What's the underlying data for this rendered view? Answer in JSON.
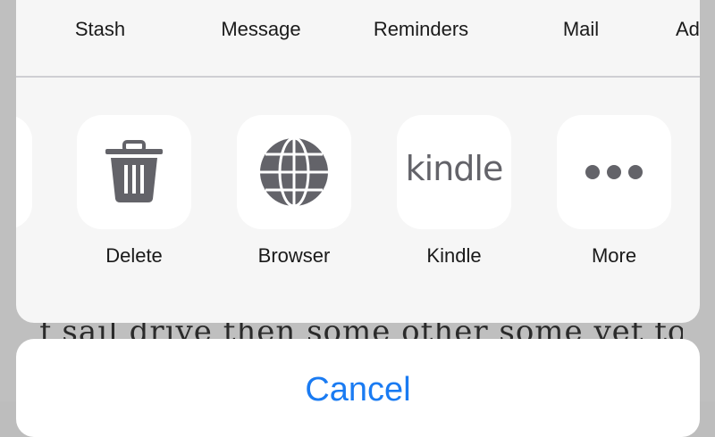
{
  "background_text": "f  sail  drive  then  some  other  some  yet  to  know",
  "share_row": {
    "apps": [
      {
        "label": "Stash",
        "icon": "stash-app-icon"
      },
      {
        "label": "Message",
        "icon": "message-app-icon"
      },
      {
        "label": "Reminders",
        "icon": "reminders-app-icon"
      },
      {
        "label": "Mail",
        "icon": "mail-app-icon"
      },
      {
        "label": "Ad",
        "icon": "add-app-icon"
      }
    ]
  },
  "action_row": {
    "actions": [
      {
        "label": "Delete",
        "icon": "trash-icon"
      },
      {
        "label": "Browser",
        "icon": "globe-icon"
      },
      {
        "label": "Kindle",
        "icon": "kindle-icon",
        "icon_text": "kindle"
      },
      {
        "label": "More",
        "icon": "more-dots-icon"
      }
    ]
  },
  "cancel": {
    "label": "Cancel"
  },
  "colors": {
    "accent": "#1a7bf2",
    "icon_gray": "#636369",
    "message_green": "#2fc246",
    "mail_blue": "#27c6f4"
  }
}
